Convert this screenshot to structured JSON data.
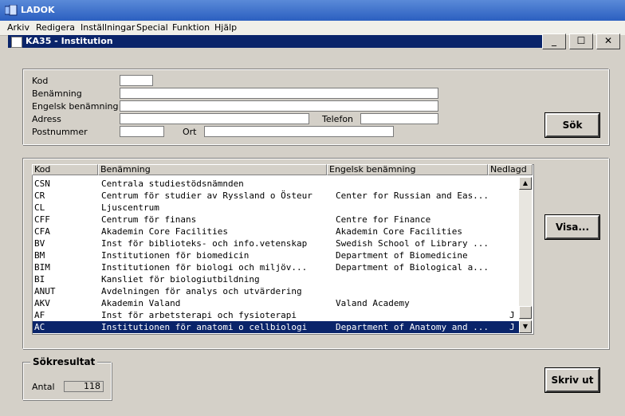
{
  "app": {
    "title": "LADOK"
  },
  "menu": [
    "Arkiv",
    "Redigera",
    "Inställningar",
    "Special",
    "Funktion",
    "Hjälp"
  ],
  "window": {
    "title": "KA35 - Institution",
    "controls": {
      "minimize": "_",
      "maximize": "☐",
      "close": "✕"
    }
  },
  "search": {
    "kod_label": "Kod",
    "benamning_label": "Benämning",
    "engelsk_label": "Engelsk benämning",
    "adress_label": "Adress",
    "telefon_label": "Telefon",
    "postnummer_label": "Postnummer",
    "ort_label": "Ort",
    "values": {
      "kod": "",
      "benamning": "",
      "engelsk": "",
      "adress": "",
      "telefon": "",
      "postnummer": "",
      "ort": ""
    },
    "sok_button": "Sök"
  },
  "list": {
    "columns": [
      "Kod",
      "Benämning",
      "Engelsk benämning",
      "Nedlagd"
    ],
    "rows": [
      {
        "kod": "CSN",
        "ben": "Centrala studiestödsnämnden",
        "eng": "",
        "ned": ""
      },
      {
        "kod": "CR",
        "ben": "Centrum för studier av Ryssland o Östeur",
        "eng": "Center for Russian and Eas...",
        "ned": ""
      },
      {
        "kod": "CL",
        "ben": "Ljuscentrum",
        "eng": "",
        "ned": ""
      },
      {
        "kod": "CFF",
        "ben": "Centrum för finans",
        "eng": "Centre for Finance",
        "ned": ""
      },
      {
        "kod": "CFA",
        "ben": "Akademin Core Facilities",
        "eng": "Akademin Core Facilities",
        "ned": ""
      },
      {
        "kod": "BV",
        "ben": "Inst för biblioteks- och info.vetenskap",
        "eng": "Swedish School of Library ...",
        "ned": ""
      },
      {
        "kod": "BM",
        "ben": "Institutionen för biomedicin",
        "eng": "Department of Biomedicine",
        "ned": ""
      },
      {
        "kod": "BIM",
        "ben": "Institutionen för biologi och miljöv...",
        "eng": "Department of Biological a...",
        "ned": ""
      },
      {
        "kod": "BI",
        "ben": "Kansliet för biologiutbildning",
        "eng": "",
        "ned": ""
      },
      {
        "kod": "ANUT",
        "ben": "Avdelningen för analys och utvärdering",
        "eng": "",
        "ned": ""
      },
      {
        "kod": "AKV",
        "ben": "Akademin Valand",
        "eng": "Valand Academy",
        "ned": ""
      },
      {
        "kod": "AF",
        "ben": "Inst för arbetsterapi och fysioterapi",
        "eng": "",
        "ned": "J"
      },
      {
        "kod": "AC",
        "ben": "Institutionen för anatomi o cellbiologi",
        "eng": "Department of Anatomy and ...",
        "ned": "J",
        "selected": true
      }
    ],
    "visa_button": "Visa..."
  },
  "result": {
    "group_title": "Sökresultat",
    "antal_label": "Antal",
    "antal_value": "118",
    "skrivut_button": "Skriv ut"
  }
}
